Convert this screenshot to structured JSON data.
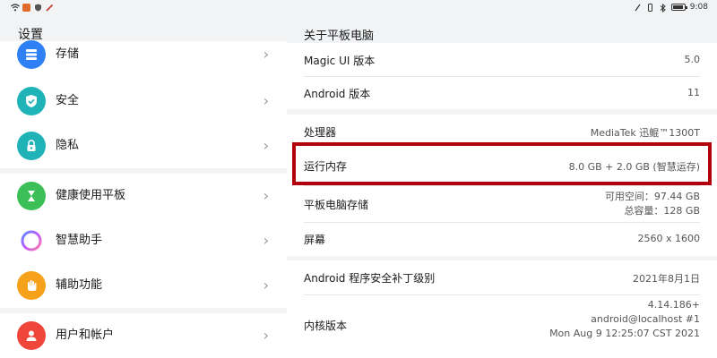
{
  "status": {
    "time": "9:08"
  },
  "left": {
    "title": "设置",
    "items": [
      {
        "label": "存储",
        "icon": "storage-icon",
        "color": "#2f7ff5"
      },
      {
        "label": "安全",
        "icon": "shield-icon",
        "color": "#1fb3b8"
      },
      {
        "label": "隐私",
        "icon": "privacy-lock-icon",
        "color": "#1fb3b8"
      },
      {
        "label": "健康使用平板",
        "icon": "hourglass-icon",
        "color": "#3cbf57"
      },
      {
        "label": "智慧助手",
        "icon": "assistant-ring-icon",
        "color": "#ffffff"
      },
      {
        "label": "辅助功能",
        "icon": "hand-icon",
        "color": "#f5a21a"
      },
      {
        "label": "用户和帐户",
        "icon": "user-icon",
        "color": "#f0453a"
      }
    ]
  },
  "right": {
    "title": "关于平板电脑",
    "rows": [
      {
        "key": "Magic UI 版本",
        "value": "5.0"
      },
      {
        "key": "Android 版本",
        "value": "11"
      },
      {
        "key": "处理器",
        "value": "MediaTek 迅鲲™1300T"
      },
      {
        "key": "运行内存",
        "value": "8.0 GB + 2.0 GB (智慧运存)"
      },
      {
        "key": "平板电脑存储",
        "value_lines": [
          "可用空间：97.44 GB",
          "总容量：128 GB"
        ]
      },
      {
        "key": "屏幕",
        "value": "2560 x 1600"
      },
      {
        "key": "Android 程序安全补丁级别",
        "value": "2021年8月1日"
      },
      {
        "key": "内核版本",
        "value_lines": [
          "4.14.186+",
          "android@localhost #1",
          "Mon Aug 9 12:25:07 CST 2021"
        ]
      }
    ]
  },
  "colors": {
    "highlight": "#b3000d"
  }
}
